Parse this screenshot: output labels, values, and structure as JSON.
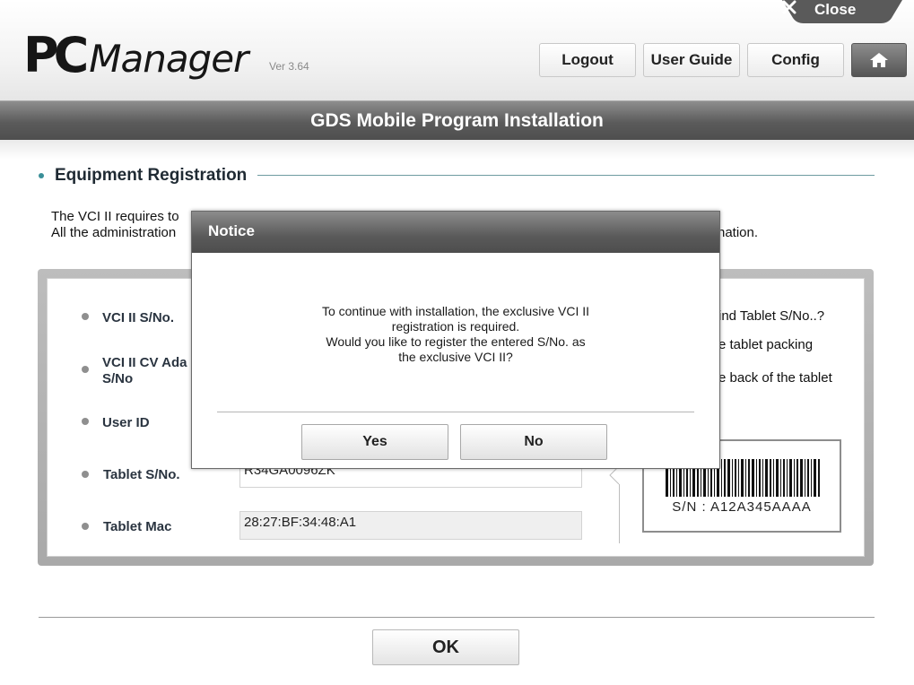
{
  "header": {
    "logo_pc": "PC",
    "logo_manager": "Manager",
    "version": "Ver 3.64",
    "close_label": "Close",
    "buttons": {
      "logout": "Logout",
      "user_guide": "User Guide",
      "config": "Config"
    }
  },
  "title": "GDS Mobile Program Installation",
  "section": {
    "title": "Equipment Registration",
    "intro_line1": "The VCI II requires to",
    "intro_line2": "All the administration",
    "intro_tail": "nation."
  },
  "form": {
    "fields": [
      {
        "label": "VCI II S/No.",
        "value": ""
      },
      {
        "label_line1": "VCI II CV Ada",
        "label_line2": "S/No",
        "value": ""
      },
      {
        "label": "User ID",
        "value": ""
      },
      {
        "label": "Tablet S/No.",
        "value": "R34GA0096ZK"
      },
      {
        "label": "Tablet Mac",
        "value": "28:27:BF:34:48:A1"
      }
    ],
    "help": {
      "line1": "ind Tablet S/No..?",
      "line2": "e tablet packing",
      "line3": "e back of the tablet"
    },
    "barcode_sn": "S/N : A12A345AAAA"
  },
  "ok_label": "OK",
  "modal": {
    "title": "Notice",
    "message_line1": "To continue with installation, the exclusive VCI II",
    "message_line2": "registration is required.",
    "message_line3": "Would you like to register the entered S/No. as",
    "message_line4": "the exclusive VCI II?",
    "yes_label": "Yes",
    "no_label": "No"
  },
  "colors": {
    "title_bar": "#5b5b5b",
    "accent_teal": "#3a8f98",
    "dialog_header": "#5a5a5a"
  }
}
